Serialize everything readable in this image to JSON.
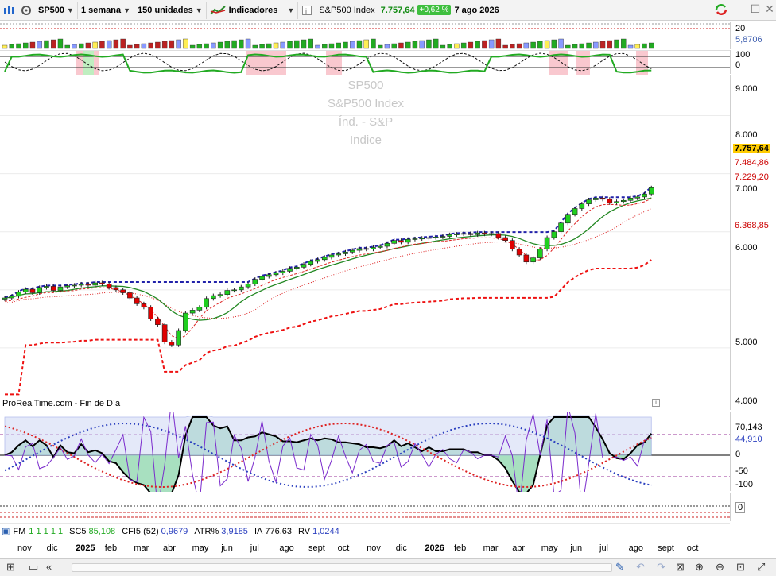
{
  "toolbar": {
    "symbol": "SP500",
    "timeframe": "1 semana",
    "units": "150 unidades",
    "indicators": "Indicadores",
    "instrument_name": "S&P500 Index",
    "price": "7.757,64",
    "change": "+0,62 %",
    "date": "7 ago 2026"
  },
  "watermark": [
    "SP500",
    "S&P500 Index",
    "Índ. - S&P",
    "Indice"
  ],
  "source_note": "ProRealTime.com - Fin de Día",
  "top_panel": {
    "labels": [
      "20",
      "5,8706"
    ]
  },
  "second_panel": {
    "labels": [
      "100",
      "0"
    ]
  },
  "price_scale": {
    "ticks": [
      "9.000",
      "8.000",
      "7.000",
      "6.000",
      "5.000",
      "4.000"
    ],
    "tags": [
      {
        "text": "7.757,64",
        "color": "#000000",
        "bg": "#ffcc00"
      },
      {
        "text": "7.484,86",
        "color": "#cc0000",
        "bg": "#ffffff"
      },
      {
        "text": "7.229,20",
        "color": "#cc0000",
        "bg": "#ffffff"
      },
      {
        "text": "6.368,85",
        "color": "#cc0000",
        "bg": "#ffffff"
      }
    ]
  },
  "osc_scale": {
    "labels": [
      "70,143",
      "44,910",
      "0",
      "-50",
      "-100"
    ]
  },
  "bottom_panel": {
    "labels": [
      "0"
    ]
  },
  "indicator_bar": {
    "fm": "FM",
    "fm_values": "1 1 1 1 1",
    "sc5_label": "SC5",
    "sc5_value": "85,108",
    "cfi5_label": "CFI5 (52)",
    "cfi5_value": "0,9679",
    "atr_label": "ATR%",
    "atr_value": "3,9185",
    "ia_label": "IA",
    "ia_value": "776,63",
    "rv_label": "RV",
    "rv_value": "1,0244"
  },
  "months": [
    "nov",
    "dic",
    "2025",
    "feb",
    "mar",
    "abr",
    "may",
    "jun",
    "jul",
    "ago",
    "sept",
    "oct",
    "nov",
    "dic",
    "2026",
    "feb",
    "mar",
    "abr",
    "may",
    "jun",
    "jul",
    "ago",
    "sept",
    "oct"
  ],
  "colors": {
    "up": "#1fcf1f",
    "down": "#e00000",
    "ma_red": "#dd2222",
    "ma_green": "#228822",
    "stop": "#ee1111",
    "resistance": "#2222aa"
  },
  "chart_data": {
    "type": "candlestick",
    "title": "SP500",
    "ylim": [
      4000,
      9500
    ],
    "x": [
      "nov",
      "dic",
      "2025",
      "feb",
      "mar",
      "abr",
      "may",
      "jun",
      "jul",
      "ago",
      "sept",
      "oct",
      "nov",
      "dic",
      "2026",
      "feb",
      "mar",
      "abr",
      "may",
      "jun",
      "jul",
      "ago"
    ],
    "close_weekly": [
      5860,
      5890,
      5960,
      6010,
      5950,
      6040,
      6060,
      5990,
      6050,
      6070,
      6080,
      6100,
      6080,
      6120,
      6100,
      6040,
      6000,
      5950,
      5860,
      5760,
      5700,
      5500,
      5400,
      5100,
      5050,
      5300,
      5600,
      5650,
      5700,
      5850,
      5900,
      5920,
      5990,
      6000,
      6050,
      6100,
      6180,
      6230,
      6260,
      6290,
      6320,
      6370,
      6390,
      6440,
      6490,
      6520,
      6560,
      6600,
      6620,
      6650,
      6680,
      6710,
      6700,
      6730,
      6750,
      6800,
      6850,
      6820,
      6870,
      6880,
      6890,
      6900,
      6910,
      6920,
      6950,
      6960,
      6970,
      6950,
      6980,
      6960,
      6970,
      6900,
      6850,
      6700,
      6600,
      6480,
      6550,
      6700,
      6900,
      7000,
      7150,
      7300,
      7400,
      7480,
      7550,
      7580,
      7560,
      7500,
      7520,
      7540,
      7580,
      7600,
      7650,
      7757.64
    ],
    "levels": {
      "last": 7757.64,
      "ma_fast": 7484.86,
      "ma_slow": 7229.2,
      "stop": 6368.85
    }
  }
}
